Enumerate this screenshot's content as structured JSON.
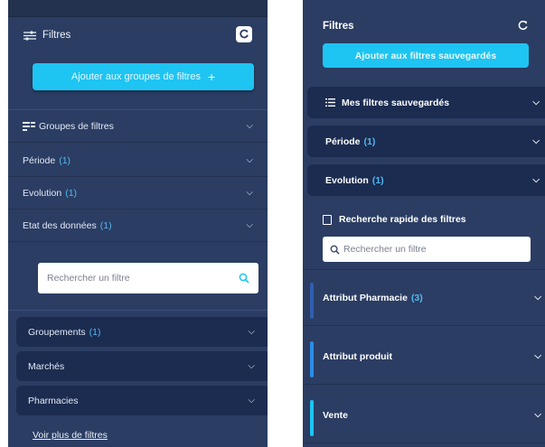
{
  "left_panel": {
    "title": "Filtres",
    "add_button": {
      "label": "Ajouter aux groupes de filtres",
      "icon": "+"
    },
    "groups_row": {
      "label": "Groupes de filtres"
    },
    "rows": [
      {
        "label": "Période",
        "count": "(1)"
      },
      {
        "label": "Evolution",
        "count": "(1)"
      },
      {
        "label": "Etat des données",
        "count": "(1)"
      }
    ],
    "search": {
      "placeholder": "Rechercher un filtre"
    },
    "cards": [
      {
        "label": "Groupements",
        "count": "(1)"
      },
      {
        "label": "Marchés",
        "count": ""
      },
      {
        "label": "Pharmacies",
        "count": ""
      }
    ],
    "more_link": "Voir plus de filtres"
  },
  "right_panel": {
    "title": "Filtres",
    "add_button": {
      "label": "Ajouter aux filtres sauvegardés"
    },
    "sections": [
      {
        "label": "Mes filtres sauvegardés",
        "count": ""
      },
      {
        "label": "Période",
        "count": "(1)"
      },
      {
        "label": "Evolution",
        "count": "(1)"
      }
    ],
    "quick_search": {
      "title": "Recherche rapide des filtres",
      "placeholder": "Rechercher un filtre"
    },
    "attributes": [
      {
        "label": "Attribut Pharmacie",
        "count": "(3)",
        "accent": "#2f5fb0"
      },
      {
        "label": "Attribut produit",
        "count": "",
        "accent": "#2b8ce8"
      },
      {
        "label": "Vente",
        "count": "",
        "accent": "#1ec4f2"
      }
    ]
  },
  "colors": {
    "panel_bg": "#2b3d63",
    "card_bg": "#1b2c50",
    "accent": "#1ec4f2",
    "count": "#53b7f0"
  }
}
